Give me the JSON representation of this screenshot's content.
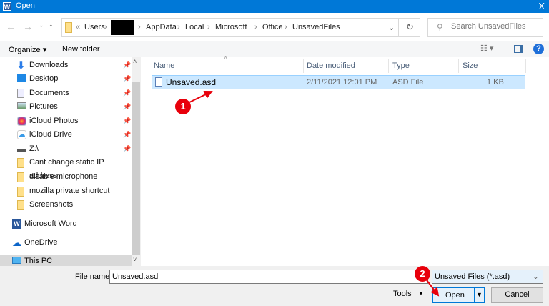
{
  "window": {
    "title": "Open",
    "close": "X",
    "app_icon": "W"
  },
  "address": {
    "back": "←",
    "forward": "→",
    "recent": "⌄",
    "up": "↑",
    "overflow": "«",
    "path": [
      "Users",
      "AppData",
      "Local",
      "Microsoft",
      "Office",
      "UnsavedFiles"
    ],
    "separator": "›",
    "dropdown": "⌄",
    "refresh": "↻"
  },
  "search": {
    "placeholder": "Search UnsavedFiles"
  },
  "toolbar": {
    "organize": "Organize ▾",
    "new_folder": "New folder",
    "help": "?"
  },
  "nav": {
    "items": [
      {
        "label": "Downloads",
        "icon": "download-icon",
        "pinned": true
      },
      {
        "label": "Desktop",
        "icon": "desktop-icon",
        "pinned": true
      },
      {
        "label": "Documents",
        "icon": "documents-icon",
        "pinned": true
      },
      {
        "label": "Pictures",
        "icon": "pictures-icon",
        "pinned": true
      },
      {
        "label": "iCloud Photos",
        "icon": "icloud-photos-icon",
        "pinned": true
      },
      {
        "label": "iCloud Drive",
        "icon": "icloud-drive-icon",
        "pinned": true
      },
      {
        "label": "Z:\\",
        "icon": "network-drive-icon",
        "pinned": true
      },
      {
        "label": "Cant change static IP address",
        "icon": "folder-icon",
        "pinned": false
      },
      {
        "label": "disable microphone",
        "icon": "folder-icon",
        "pinned": false
      },
      {
        "label": "mozilla private shortcut",
        "icon": "folder-icon",
        "pinned": false
      },
      {
        "label": "Screenshots",
        "icon": "folder-icon",
        "pinned": false
      }
    ],
    "microsoft_word": "Microsoft Word",
    "onedrive": "OneDrive",
    "this_pc": "This PC"
  },
  "columns": [
    "Name",
    "Date modified",
    "Type",
    "Size"
  ],
  "files": [
    {
      "name": "Unsaved.asd",
      "date": "2/11/2021 12:01 PM",
      "type": "ASD File",
      "size": "1 KB",
      "selected": true
    }
  ],
  "bottom": {
    "file_name_label": "File name:",
    "file_name_value": "Unsaved.asd",
    "filter": "Unsaved Files (*.asd)",
    "tools": "Tools",
    "open": "Open",
    "cancel": "Cancel"
  },
  "annotations": {
    "step1": "1",
    "step2": "2",
    "color": "#e8000b"
  }
}
